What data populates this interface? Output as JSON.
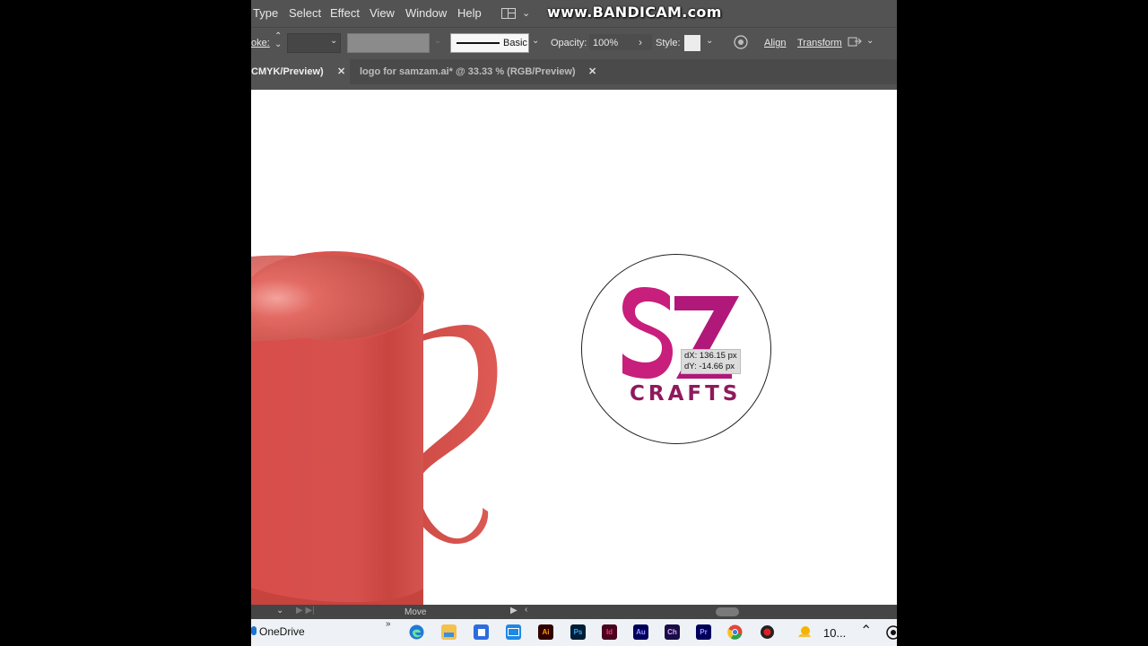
{
  "menu": {
    "items": [
      "Type",
      "Select",
      "Effect",
      "View",
      "Window",
      "Help"
    ]
  },
  "watermark": "www.BANDICAM.com",
  "control_bar": {
    "stroke_label": "oke:",
    "brush_label": "Basic",
    "opacity_label": "Opacity:",
    "opacity_value": "100%",
    "style_label": "Style:",
    "align_label": "Align",
    "transform_label": "Transform"
  },
  "tabs": [
    {
      "label": "CMYK/Preview)",
      "active": true
    },
    {
      "label": "logo for samzam.ai* @ 33.33 % (RGB/Preview)",
      "active": false
    }
  ],
  "canvas": {
    "logo_letters": "SZ",
    "logo_text": "CRAFTS",
    "logo_colors": {
      "s": "#c81e7c",
      "z": "#b0187a",
      "crafts": "#8e1a5c"
    },
    "mug_color": "#d9534f",
    "readout": {
      "dx": "dX: 136.15 px",
      "dy": "dY: -14.66 px"
    }
  },
  "status_bar": {
    "tool": "Move"
  },
  "taskbar": {
    "onedrive": "OneDrive",
    "clock_partial": "10...",
    "apps": [
      {
        "name": "edge-icon",
        "label": "e",
        "color": "#1f7ad8"
      },
      {
        "name": "file-explorer-icon",
        "label": "",
        "color": "#f2c14e"
      },
      {
        "name": "store-icon",
        "label": "",
        "color": "#2d6cdf"
      },
      {
        "name": "mail-icon",
        "label": "",
        "color": "#1e88e5"
      },
      {
        "name": "illustrator-icon",
        "label": "Ai",
        "color": "#300000"
      },
      {
        "name": "photoshop-icon",
        "label": "Ps",
        "color": "#001d34"
      },
      {
        "name": "indesign-icon",
        "label": "Id",
        "color": "#49021f"
      },
      {
        "name": "audition-icon",
        "label": "Au",
        "color": "#00005b"
      },
      {
        "name": "character-animator-icon",
        "label": "Ch",
        "color": "#1a0d45"
      },
      {
        "name": "premiere-icon",
        "label": "Pr",
        "color": "#00005b"
      },
      {
        "name": "chrome-icon",
        "label": "",
        "color": "#e0463a"
      },
      {
        "name": "bandicam-icon",
        "label": "",
        "color": "#222222"
      }
    ]
  }
}
